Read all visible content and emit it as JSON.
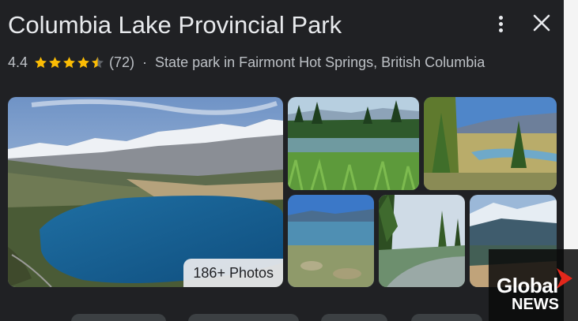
{
  "header": {
    "title": "Columbia Lake Provincial Park",
    "more_icon": "more-vertical-icon",
    "close_icon": "close-icon"
  },
  "summary": {
    "rating": "4.4",
    "stars": 4.4,
    "review_count": "(72)",
    "separator": "·",
    "description": "State park in Fairmont Hot Springs, British Columbia"
  },
  "photos": {
    "count_label": "186+ Photos"
  },
  "watermark": {
    "line1": "Global",
    "line2": "NEWS"
  },
  "colors": {
    "panel_bg": "#202124",
    "text_primary": "#e8eaed",
    "text_secondary": "#bdc1c6",
    "star": "#fbbc04",
    "logo_accent": "#e3271b"
  }
}
